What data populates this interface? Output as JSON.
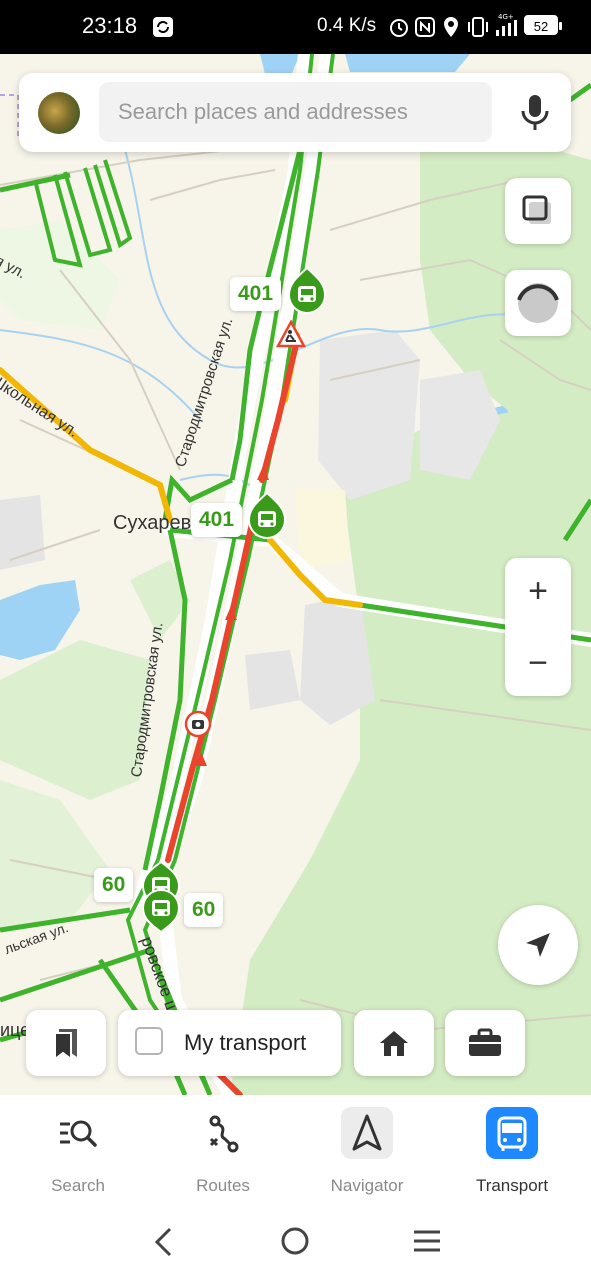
{
  "status_bar": {
    "time": "23:18",
    "network_speed": "0.4 K/s",
    "battery_level": "52",
    "icons": [
      "sync-icon",
      "alarm-icon",
      "nfc-icon",
      "location-icon",
      "vibrate-icon",
      "signal-4g-icon",
      "battery-icon"
    ]
  },
  "search": {
    "placeholder": "Search places and addresses"
  },
  "map": {
    "transit_markers": [
      {
        "route": "401"
      },
      {
        "route": "401"
      },
      {
        "route": "60"
      },
      {
        "route": "60"
      }
    ],
    "places": {
      "village": "Сухарев",
      "street_shkolnaya": "Школьная ул.",
      "street_starodmitrovskaya_1": "Стародмитровская ул.",
      "street_starodmitrovskaya_2": "Стародмитровская ул.",
      "street_starodmitrovskaya_3": "Стародмитровская ул.",
      "street_ul": "я ул.",
      "street_bottom": "ровское ш.",
      "street_bottom_left": "льская ул.",
      "area_bottom_left": "ице-Со"
    },
    "traffic_colors": {
      "free": "#3fb32c",
      "medium": "#f2b705",
      "heavy": "#e8452c"
    }
  },
  "controls": {
    "zoom_in": "+",
    "zoom_out": "−"
  },
  "quick_actions": {
    "my_transport_label": "My transport"
  },
  "tabbar": {
    "active_color": "#1e88ff",
    "items": [
      {
        "label": "Search",
        "icon": "search-list-icon"
      },
      {
        "label": "Routes",
        "icon": "routes-icon"
      },
      {
        "label": "Navigator",
        "icon": "navigator-arrow-icon"
      },
      {
        "label": "Transport",
        "icon": "bus-icon"
      }
    ]
  },
  "system_nav": [
    "back-icon",
    "home-icon",
    "menu-icon"
  ]
}
